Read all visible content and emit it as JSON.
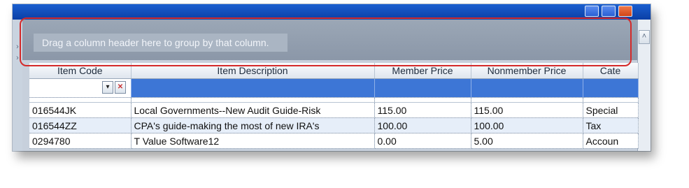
{
  "group_panel": {
    "hint": "Drag a column header here to group by that column."
  },
  "grid": {
    "columns": [
      "Item Code",
      "Item Description",
      "Member Price",
      "Nonmember Price",
      "Cate"
    ],
    "rows": [
      [
        "016544JK",
        "Local Governments--New Audit Guide-Risk",
        "115.00",
        "115.00",
        "Special"
      ],
      [
        "016544ZZ",
        "CPA's guide-making the most of new IRA's",
        "100.00",
        "100.00",
        "Tax"
      ],
      [
        "0294780",
        "T Value Software12",
        "0.00",
        "5.00",
        "Accoun"
      ]
    ]
  },
  "filter_row": {
    "dropdown_icon": "chevron-down-icon",
    "clear_icon": "clear-filter-icon"
  },
  "colors": {
    "highlight": "#d42a2a",
    "filter_row": "#3d76d6",
    "title_bar": "#0b3fa6"
  }
}
